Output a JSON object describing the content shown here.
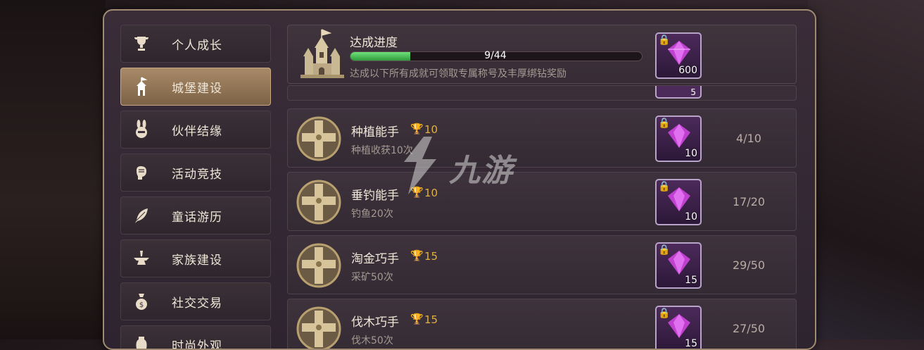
{
  "sidebar": {
    "items": [
      {
        "label": "个人成长",
        "icon": "trophy-icon",
        "active": false
      },
      {
        "label": "城堡建设",
        "icon": "castle-icon",
        "active": true
      },
      {
        "label": "伙伴结缘",
        "icon": "bunny-helmet-icon",
        "active": false
      },
      {
        "label": "活动竞技",
        "icon": "fist-icon",
        "active": false
      },
      {
        "label": "童话游历",
        "icon": "feather-icon",
        "active": false
      },
      {
        "label": "家族建设",
        "icon": "anvil-icon",
        "active": false
      },
      {
        "label": "社交交易",
        "icon": "money-bag-icon",
        "active": false
      },
      {
        "label": "时尚外观",
        "icon": "vase-icon",
        "active": false
      }
    ]
  },
  "summary": {
    "title": "达成进度",
    "progress_text": "9/44",
    "progress_fraction": 0.2045,
    "description": "达成以下所有成就可领取专属称号及丰厚绑钻奖励",
    "reward_count": "600",
    "peek_count": "5"
  },
  "achievements": [
    {
      "title": "种植能手",
      "points": "10",
      "description": "种植收获10次",
      "reward": "10",
      "progress": "4/10"
    },
    {
      "title": "垂钓能手",
      "points": "10",
      "description": "钓鱼20次",
      "reward": "10",
      "progress": "17/20"
    },
    {
      "title": "淘金巧手",
      "points": "15",
      "description": "采矿50次",
      "reward": "15",
      "progress": "29/50"
    },
    {
      "title": "伐木巧手",
      "points": "15",
      "description": "伐木50次",
      "reward": "15",
      "progress": "27/50"
    }
  ],
  "watermark": {
    "text": "九游"
  },
  "colors": {
    "accent_gold": "#e0b040",
    "progress_green": "#4cc55a",
    "gem_purple": "#c040d0",
    "active_tab": "#a88a68"
  }
}
